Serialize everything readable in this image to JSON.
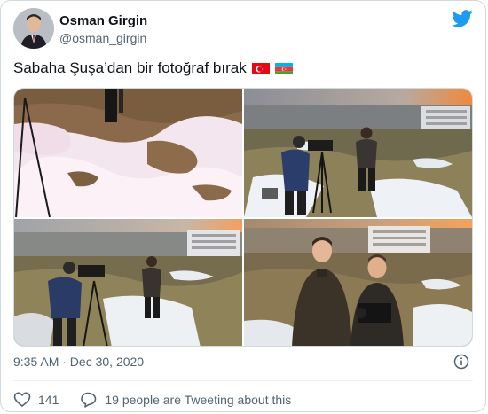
{
  "author": {
    "name": "Osman Girgin",
    "handle": "@osman_girgin"
  },
  "tweet": {
    "text": "Sabaha Şuşa’dan bir fotoğraf bırak",
    "flags": [
      "turkey-flag",
      "azerbaijan-flag"
    ],
    "timestamp": "9:35 AM · Dec 30, 2020"
  },
  "media": {
    "photos": [
      "photo-snowy-hillside-tripod",
      "photo-cameraman-and-reporter",
      "photo-cameraman-filming-reporter",
      "photo-two-men-posing-sunset"
    ]
  },
  "actions": {
    "likes": "141",
    "conversation": "19 people are Tweeting about this"
  },
  "colors": {
    "twitter_blue": "#1d9bf0",
    "text_primary": "#0f1419",
    "text_secondary": "#536471",
    "like_red": "#f91880"
  }
}
